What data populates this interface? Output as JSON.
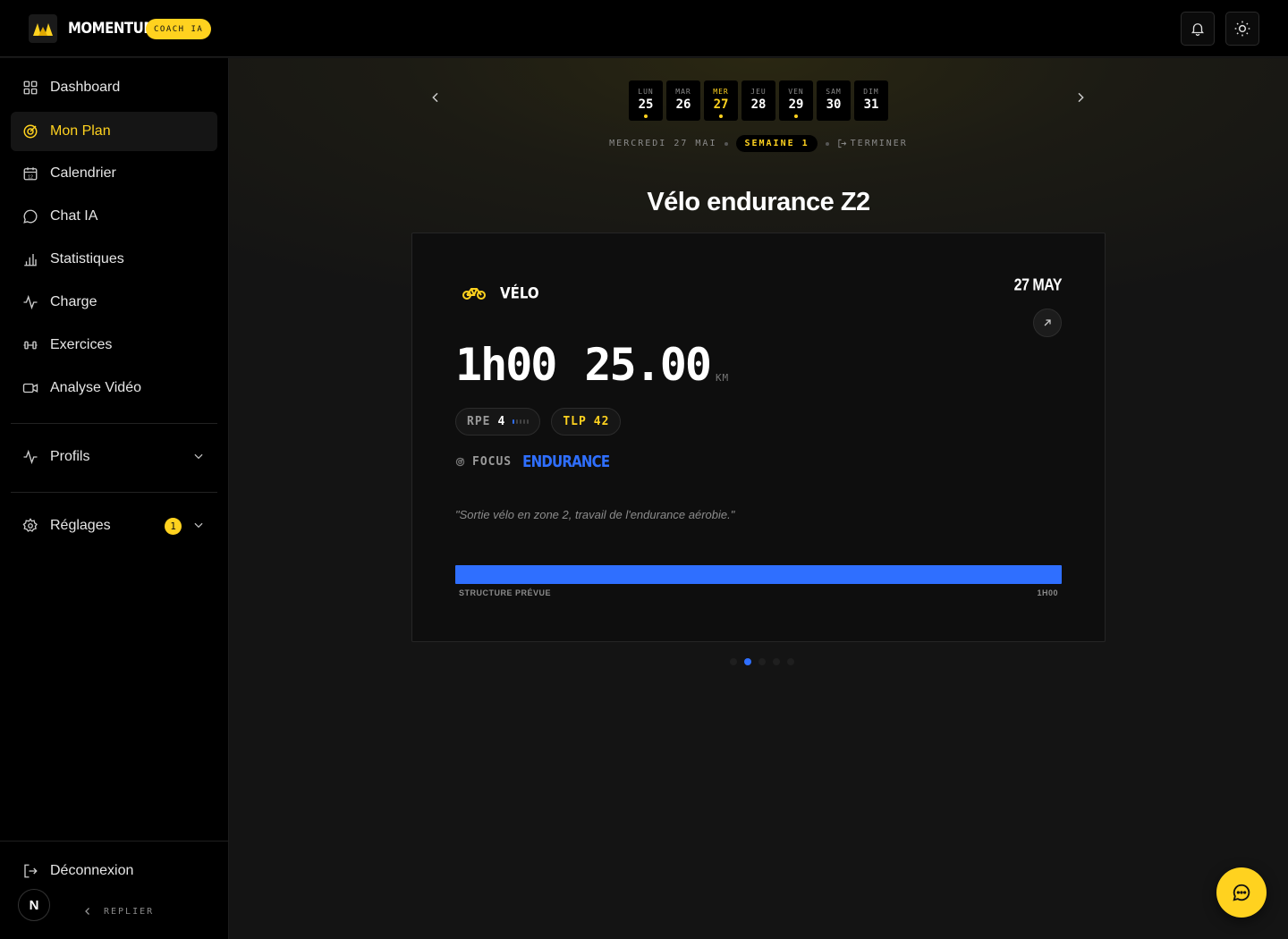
{
  "app": {
    "brand": "MOMENTUM",
    "badge": "COACH IA"
  },
  "sidebar": {
    "items": [
      {
        "label": "Dashboard",
        "icon": "grid-icon"
      },
      {
        "label": "Mon Plan",
        "icon": "target-icon",
        "active": true
      },
      {
        "label": "Calendrier",
        "icon": "calendar-icon"
      },
      {
        "label": "Chat IA",
        "icon": "chat-bubble-icon"
      },
      {
        "label": "Statistiques",
        "icon": "bar-chart-icon"
      },
      {
        "label": "Charge",
        "icon": "activity-icon"
      },
      {
        "label": "Exercices",
        "icon": "dumbbell-icon"
      },
      {
        "label": "Analyse Vidéo",
        "icon": "video-icon"
      }
    ],
    "profiles": {
      "label": "Profils"
    },
    "settings": {
      "label": "Réglages",
      "badge": "1"
    },
    "logout": "Déconnexion",
    "avatar": "N",
    "collapse": "REPLIER"
  },
  "week": {
    "days": [
      {
        "name": "LUN",
        "num": "25",
        "dot": true
      },
      {
        "name": "MAR",
        "num": "26",
        "dot": false
      },
      {
        "name": "MER",
        "num": "27",
        "dot": true,
        "selected": true
      },
      {
        "name": "JEU",
        "num": "28",
        "dot": false
      },
      {
        "name": "VEN",
        "num": "29",
        "dot": true
      },
      {
        "name": "SAM",
        "num": "30",
        "dot": false
      },
      {
        "name": "DIM",
        "num": "31",
        "dot": false
      }
    ],
    "current_date": "MERCREDI 27 MAI",
    "week_label": "SEMAINE 1",
    "finish": "TERMINER"
  },
  "session": {
    "title": "Vélo endurance Z2",
    "sport": "VÉLO",
    "date": "27 MAY",
    "duration": "1h00",
    "distance": "25.00",
    "distance_unit": "KM",
    "rpe_label": "RPE",
    "rpe_value": "4",
    "rpe_level": 0.4,
    "tlp_label": "TLP",
    "tlp_value": "42",
    "focus_label": "FOCUS",
    "focus_value": "ENDURANCE",
    "description": "\"Sortie vélo en zone 2, travail de l'endurance aérobie.\"",
    "structure_label": "STRUCTURE PRÉVUE",
    "structure_duration": "1H00"
  },
  "pager": {
    "count": 5,
    "active": 1
  },
  "colors": {
    "accent": "#ffd21f",
    "blue": "#2f6fff",
    "bg": "#000000"
  }
}
